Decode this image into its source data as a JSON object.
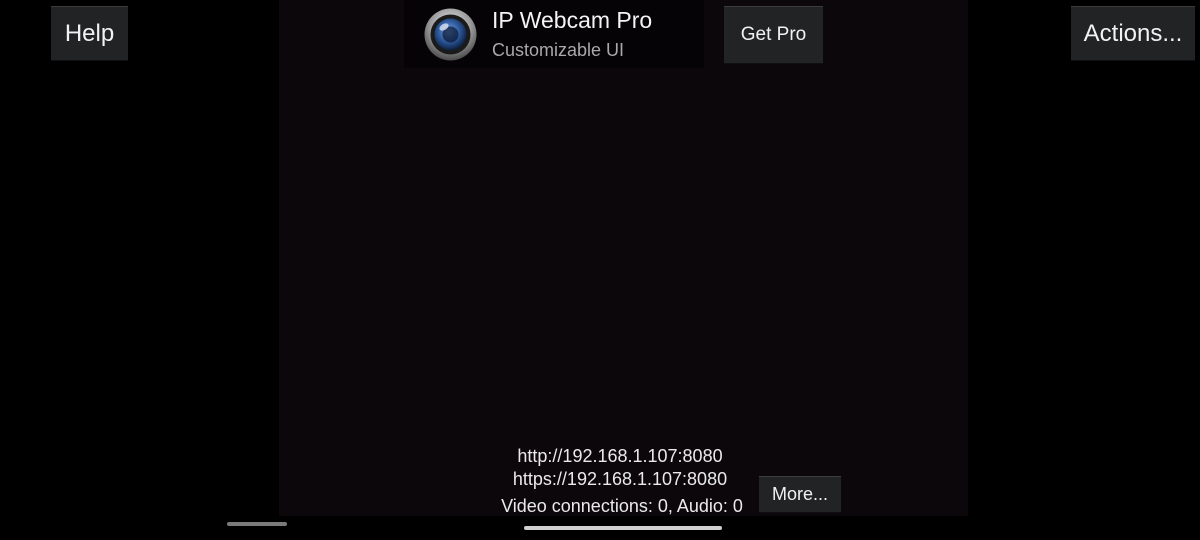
{
  "header": {
    "help_label": "Help",
    "actions_label": "Actions...",
    "get_pro_label": "Get Pro",
    "app_title": "IP Webcam Pro",
    "app_subtitle": "Customizable UI",
    "app_icon": "camera-lens-icon"
  },
  "server_info": {
    "http_url": "http://192.168.1.107:8080",
    "https_url": "https://192.168.1.107:8080",
    "connections": "Video connections: 0, Audio: 0",
    "more_label": "More..."
  },
  "colors": {
    "background": "#000000",
    "preview": "#0b070b",
    "button": "#212325",
    "text": "#f2f2f2",
    "subtitle": "#a9a9a9"
  }
}
